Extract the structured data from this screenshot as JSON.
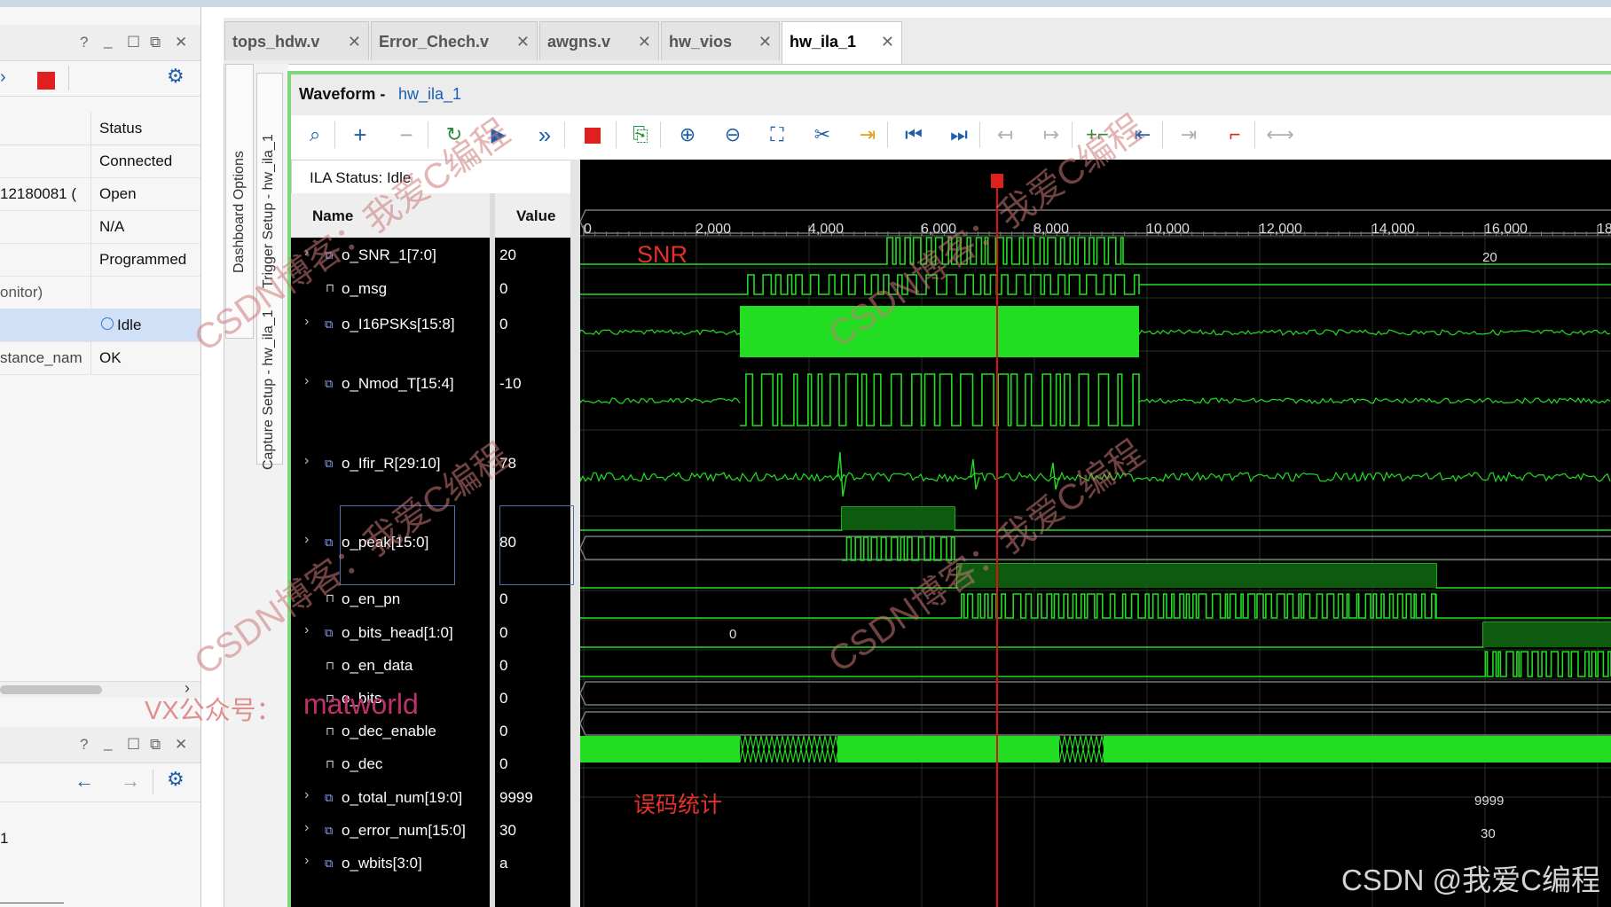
{
  "left_panel": {
    "top_window_buttons": [
      "?",
      "_",
      "☐",
      "⧉",
      "✕"
    ],
    "table_header": "Status",
    "rows": [
      {
        "c1": "",
        "c2": "Connected"
      },
      {
        "c1": "12180081 (",
        "c2": "Open"
      },
      {
        "c1": "",
        "c2": "N/A"
      },
      {
        "c1": "",
        "c2": "Programmed"
      },
      {
        "c1": "onitor)",
        "c2": ""
      },
      {
        "c1": "",
        "c2": "Idle"
      },
      {
        "c1": "stance_nam",
        "c2": "OK"
      }
    ],
    "bottom_window_buttons": [
      "?",
      "_",
      "☐",
      "⧉",
      "✕"
    ],
    "bottom_text": "1"
  },
  "tabs": [
    {
      "label": "tops_hdw.v"
    },
    {
      "label": "Error_Chech.v"
    },
    {
      "label": "awgns.v"
    },
    {
      "label": "hw_vios"
    },
    {
      "label": "hw_ila_1"
    }
  ],
  "side_tabs": [
    "Dashboard Options",
    "Capture Setup - hw_ila_1",
    "Trigger Setup - hw_ila_1"
  ],
  "waveform": {
    "title_prefix": "Waveform - ",
    "title_link": "hw_ila_1",
    "ila_status": "ILA Status:  Idle",
    "col_name": "Name",
    "col_value": "Value",
    "ticks": [
      "0",
      "2,000",
      "4,000",
      "6,000",
      "8,000",
      "10,000",
      "12,000",
      "14,000",
      "16,000",
      "18"
    ],
    "signals": [
      {
        "name": "o_SNR_1[7:0]",
        "value": "20",
        "bus": true,
        "inline": "20"
      },
      {
        "name": "o_msg",
        "value": "0",
        "bus": false
      },
      {
        "name": "o_I16PSKs[15:8]",
        "value": "0",
        "bus": true
      },
      {
        "name": "o_Nmod_T[15:4]",
        "value": "-10",
        "bus": true
      },
      {
        "name": "o_Ifir_R[29:10]",
        "value": "78",
        "bus": true
      },
      {
        "name": "o_peak[15:0]",
        "value": "80",
        "bus": true
      },
      {
        "name": "o_en_pn",
        "value": "0",
        "bus": false
      },
      {
        "name": "o_bits_head[1:0]",
        "value": "0",
        "bus": true,
        "inline": "0"
      },
      {
        "name": "o_en_data",
        "value": "0",
        "bus": false
      },
      {
        "name": "o_bits",
        "value": "0",
        "bus": false
      },
      {
        "name": "o_dec_enable",
        "value": "0",
        "bus": false
      },
      {
        "name": "o_dec",
        "value": "0",
        "bus": false
      },
      {
        "name": "o_total_num[19:0]",
        "value": "9999",
        "bus": true,
        "inline": "9999"
      },
      {
        "name": "o_error_num[15:0]",
        "value": "30",
        "bus": true,
        "inline": "30"
      },
      {
        "name": "o_wbits[3:0]",
        "value": "a",
        "bus": true
      }
    ],
    "annotations": {
      "snr": "SNR",
      "error_stat": "误码统计"
    },
    "colors": {
      "wave": "#22dd22",
      "bg": "#000000",
      "cursor": "#dd1111",
      "frame": "#7ed67e"
    }
  },
  "watermarks": {
    "csdn": "CSDN博客：我爱C编程",
    "vx_prefix": "VX公众号：",
    "vx_name": "matworld",
    "footer": "CSDN @我爱C编程"
  }
}
